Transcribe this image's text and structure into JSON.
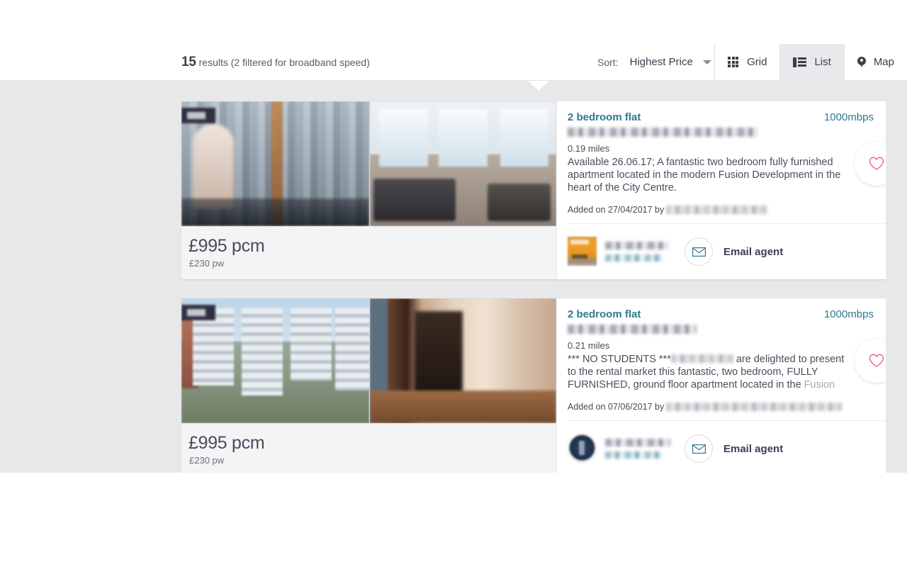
{
  "header": {
    "results_number": "15",
    "results_text": "results (2 filtered for broadband speed)",
    "sort_label": "Sort:",
    "sort_value": "Highest Price",
    "sort_caret_icon": "chevron-down-icon",
    "views": [
      {
        "label": "Grid",
        "icon": "grid-icon",
        "active": false
      },
      {
        "label": "List",
        "icon": "list-icon",
        "active": true
      },
      {
        "label": "Map",
        "icon": "map-pin-icon",
        "active": false
      }
    ]
  },
  "listings": [
    {
      "title": "2 bedroom flat",
      "broadband_speed": "1000mbps",
      "address_redacted": true,
      "distance": "0.19 miles",
      "description": "Available 26.06.17; A fantastic two bedroom fully furnished apartment located in the modern Fusion Development in the heart of the City Centre.",
      "added_prefix": "Added on 27/04/2017 by",
      "agent_redacted": true,
      "price_main": "£995 pcm",
      "price_sub": "£230 pw",
      "email_agent_label": "Email agent",
      "email_icon": "envelope-icon",
      "favourite_icon": "heart-icon",
      "photo_badge_icon": "photo-count-badge"
    },
    {
      "title": "2 bedroom flat",
      "broadband_speed": "1000mbps",
      "address_redacted": true,
      "distance": "0.21 miles",
      "description_part1": "*** NO STUDENTS ***",
      "description_part2": " are delighted to present to the rental market this fantastic, two bedroom, FULLY FURNISHED, ground floor apartment located in the ",
      "description_truncated": "Fusion",
      "added_prefix": "Added on 07/06/2017 by",
      "agent_redacted": true,
      "price_main": "£995 pcm",
      "price_sub": "£230 pw",
      "email_agent_label": "Email agent",
      "email_icon": "envelope-icon",
      "favourite_icon": "heart-icon",
      "photo_badge_icon": "photo-count-badge"
    }
  ],
  "colors": {
    "accent_teal": "#2b7b8c",
    "text_dark": "#3d3d50",
    "page_bg": "#e8e8ea",
    "card_bg": "#ffffff",
    "price_bg": "#f4f4f5",
    "heart_pink": "#e8487d"
  }
}
